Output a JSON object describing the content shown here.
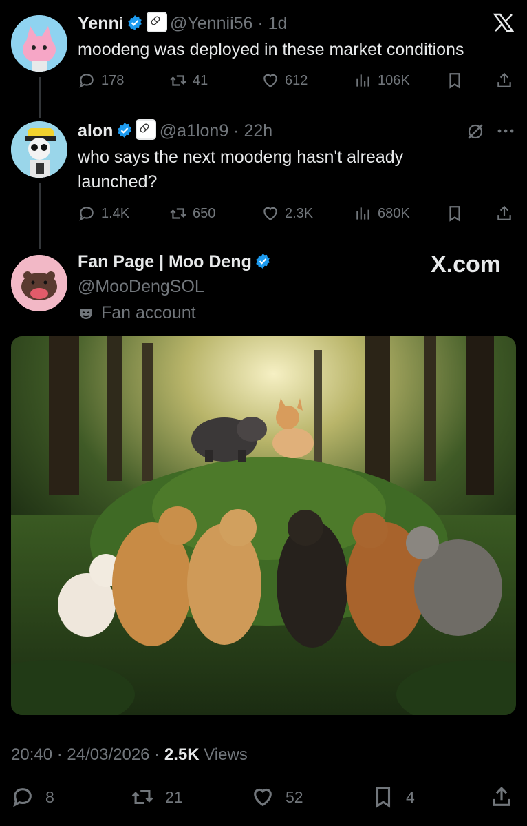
{
  "tweet1": {
    "name": "Yenni",
    "handle": "@Yennii56",
    "time": "1d",
    "text": "moodeng was deployed in these market conditions",
    "replies": "178",
    "reposts": "41",
    "likes": "612",
    "views": "106K"
  },
  "tweet2": {
    "name": "alon",
    "handle": "@a1lon9",
    "time": "22h",
    "text_line1": "who says the next moodeng hasn't already",
    "text_line2": "launched?",
    "replies": "1.4K",
    "reposts": "650",
    "likes": "2.3K",
    "views": "680K"
  },
  "tweet3": {
    "name": "Fan Page | Moo Deng",
    "handle": "@MooDengSOL",
    "label": "Fan account",
    "watermark": "X.com",
    "time": "20:40",
    "date": "24/03/2026",
    "views_count": "2.5K",
    "views_label": "Views",
    "replies": "8",
    "reposts": "21",
    "likes": "52",
    "bookmarks": "4"
  },
  "icons": [
    "x-logo-icon",
    "verified-icon",
    "reply-icon",
    "repost-icon",
    "like-icon",
    "views-icon",
    "bookmark-icon",
    "share-icon",
    "more-icon",
    "grok-icon",
    "fan-mask-icon"
  ],
  "colors": {
    "background": "#000000",
    "verified": "#1d9bf0",
    "muted": "#71767b",
    "text": "#e7e9ea"
  }
}
